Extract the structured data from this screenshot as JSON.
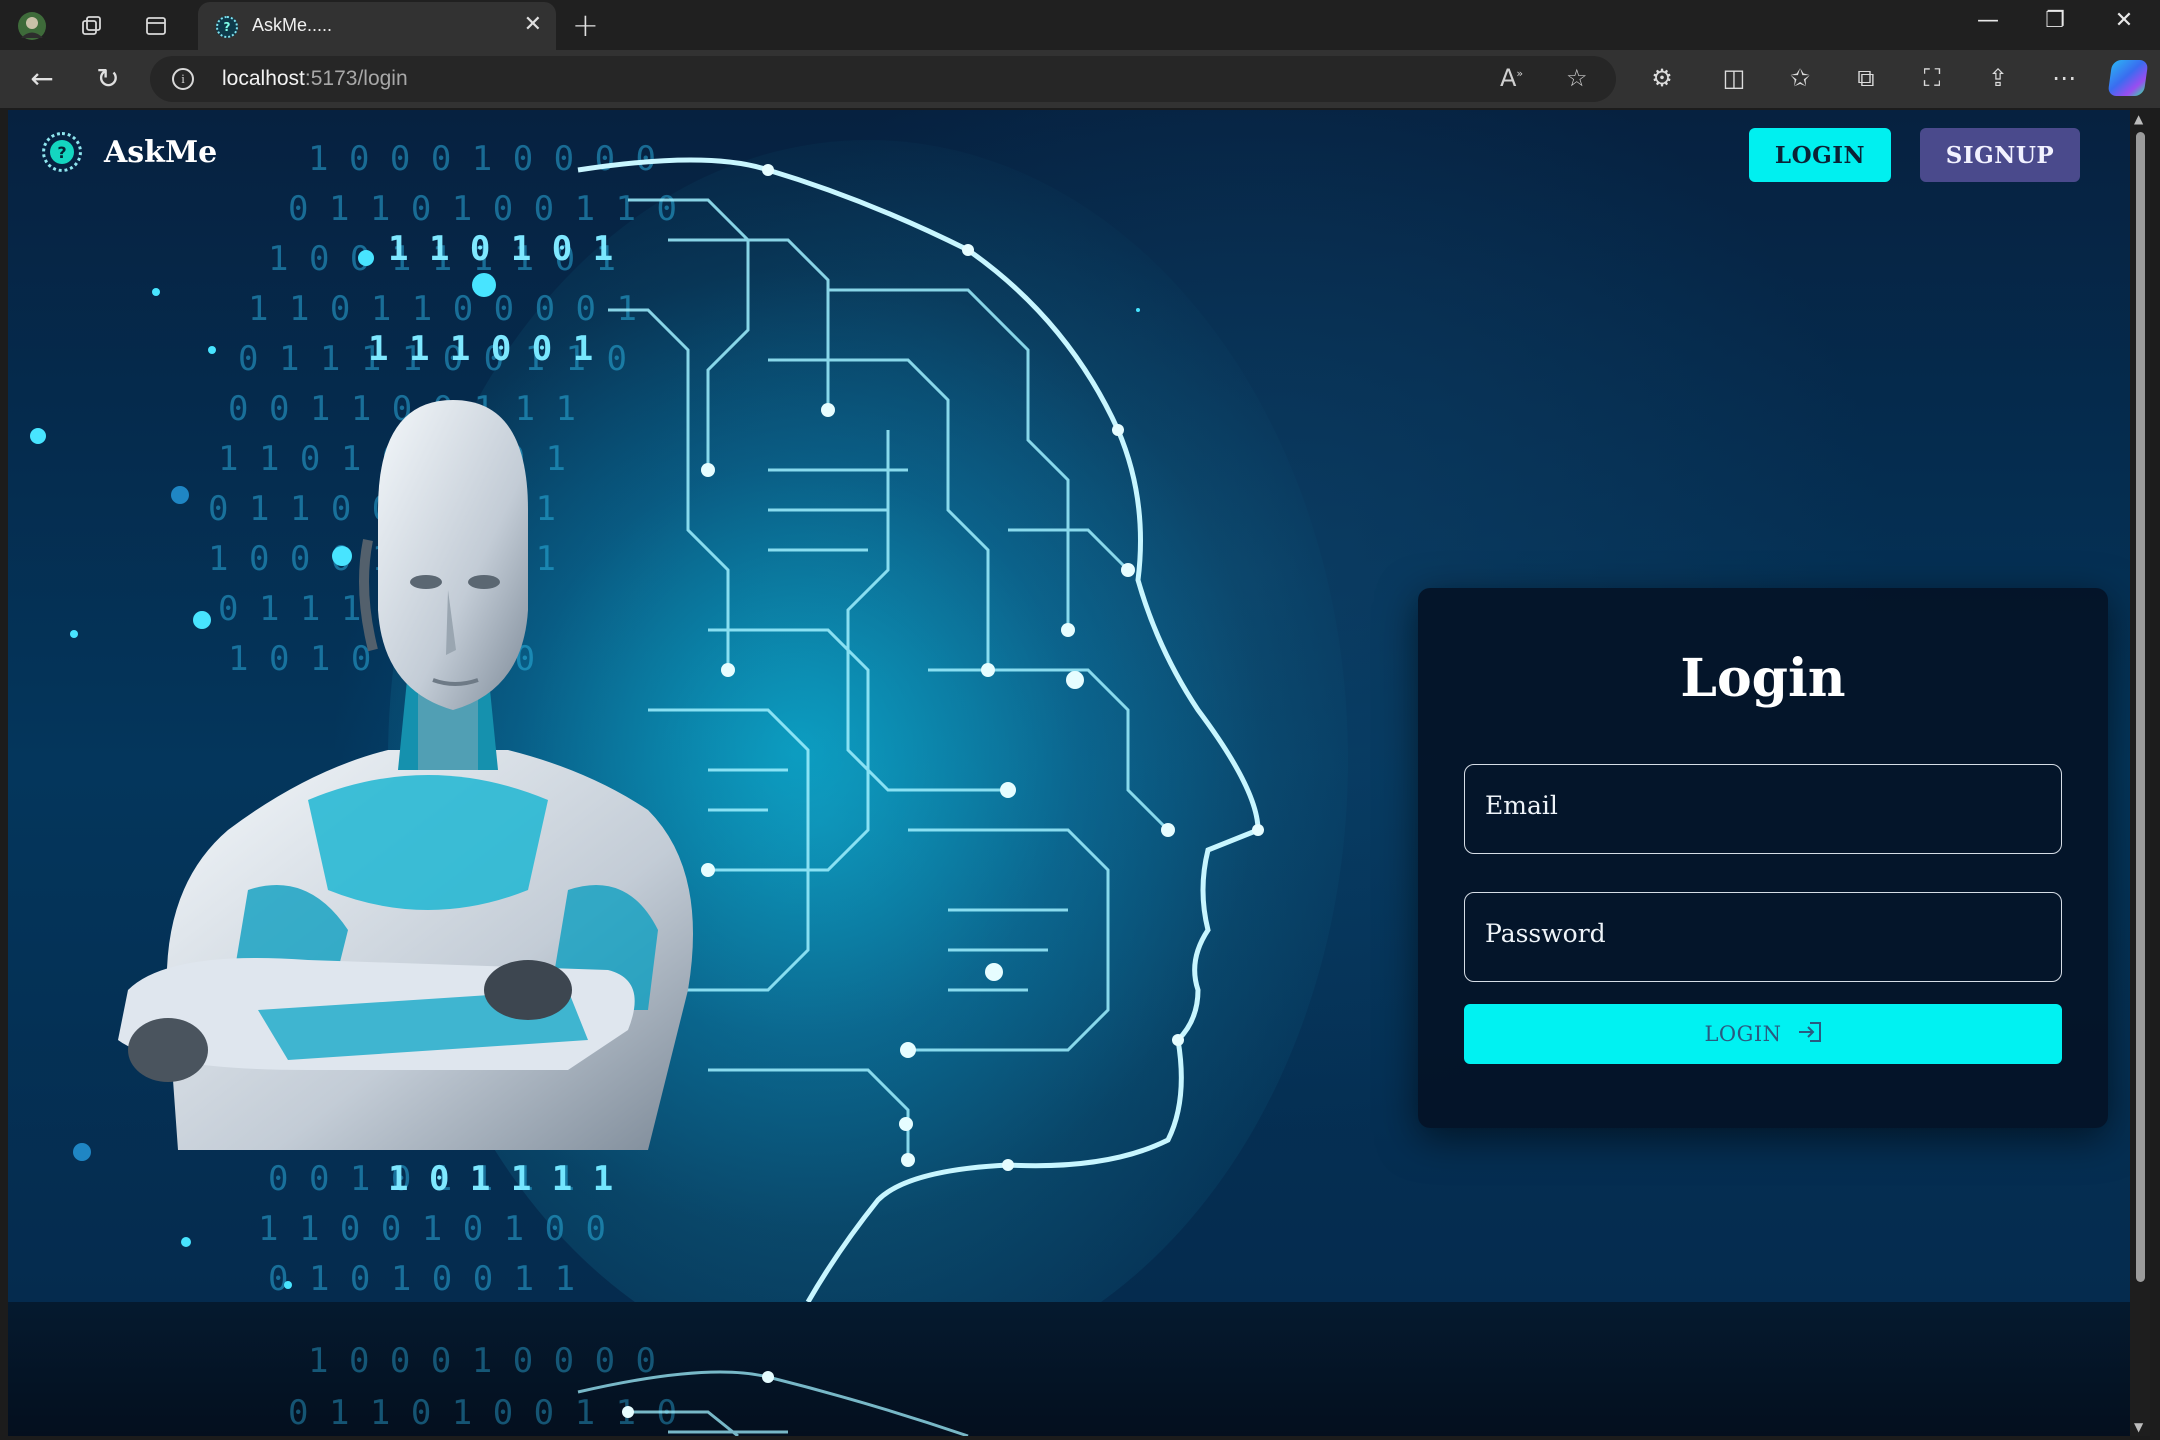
{
  "browser": {
    "tab": {
      "title": "AskMe.....",
      "close_glyph": "✕"
    },
    "new_tab_glyph": "+",
    "window": {
      "minimize": "—",
      "restore": "❐",
      "close": "✕"
    },
    "address": {
      "host": "localhost",
      "path": ":5173/login"
    },
    "toolbar_icons": [
      "read-aloud-icon",
      "favorite-star-icon",
      "extensions-icon",
      "split-screen-icon",
      "favorites-icon",
      "collections-icon",
      "screenshot-icon",
      "share-icon",
      "more-icon",
      "copilot-icon"
    ]
  },
  "app": {
    "brand": {
      "name": "AskMe",
      "logo_glyph": "?"
    },
    "nav": {
      "login_label": "LOGIN",
      "signup_label": "SIGNUP"
    },
    "login_card": {
      "title": "Login",
      "email_placeholder": "Email",
      "password_placeholder": "Password",
      "submit_label": "LOGIN"
    }
  },
  "colors": {
    "accent_cyan": "#00f0f0",
    "signup_purple": "#4a4a8c",
    "card_bg": "#041226"
  }
}
